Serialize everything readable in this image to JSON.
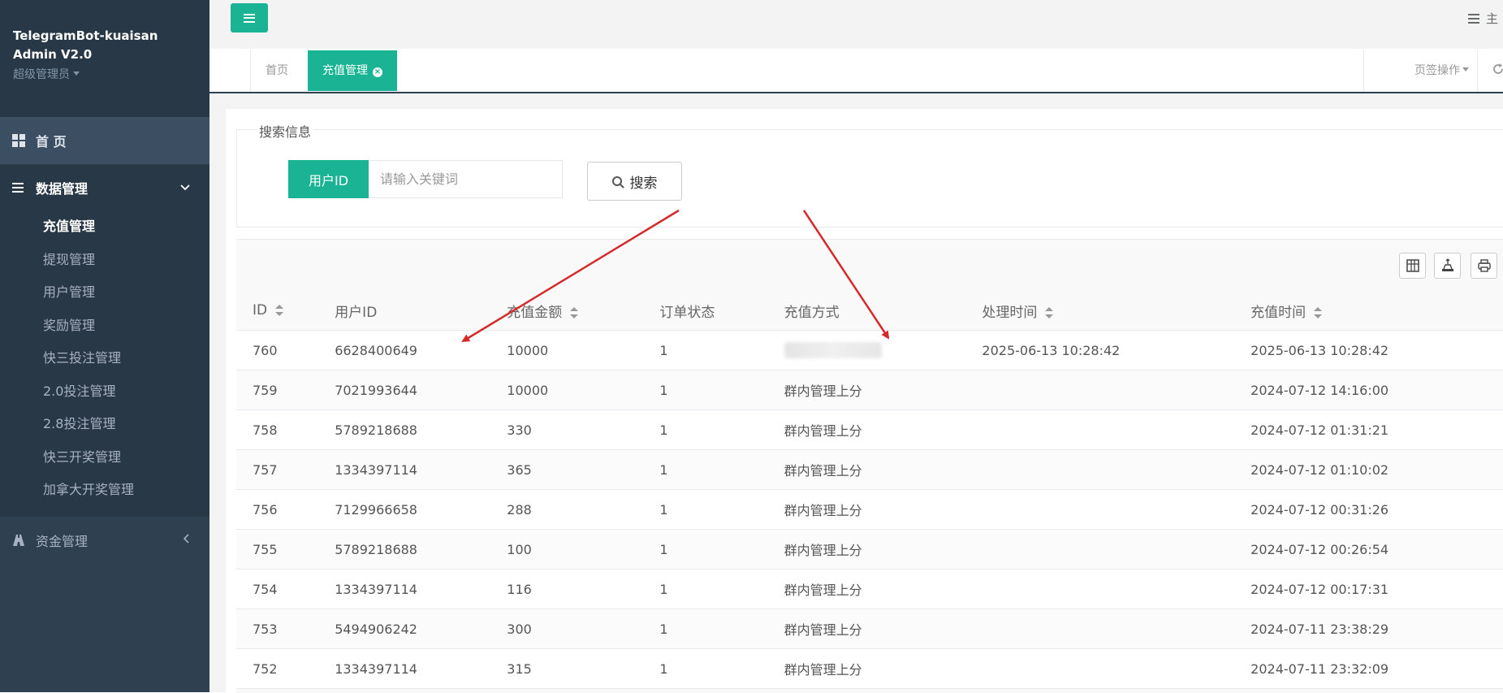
{
  "sidebar": {
    "brand_line1": "TelegramBot-kuaisan",
    "brand_line2": "Admin V2.0",
    "role": "超级管理员",
    "home_label": "首 页",
    "data_mgmt_label": "数据管理",
    "data_mgmt_items": [
      {
        "label": "充值管理",
        "active": true
      },
      {
        "label": "提现管理"
      },
      {
        "label": "用户管理"
      },
      {
        "label": "奖励管理"
      },
      {
        "label": "快三投注管理"
      },
      {
        "label": "2.0投注管理"
      },
      {
        "label": "2.8投注管理"
      },
      {
        "label": "快三开奖管理"
      },
      {
        "label": "加拿大开奖管理"
      }
    ],
    "funds_label": "资金管理"
  },
  "topbar": {
    "right_text": "主"
  },
  "tabs": {
    "items": [
      {
        "label": "首页"
      },
      {
        "label": "充值管理",
        "active": true
      }
    ],
    "ops_label": "页签操作"
  },
  "search": {
    "legend": "搜索信息",
    "field_label": "用户ID",
    "placeholder": "请输入关键词",
    "value": "",
    "button_label": "搜索"
  },
  "table": {
    "columns": [
      "ID",
      "用户ID",
      "充值金额",
      "订单状态",
      "充值方式",
      "处理时间",
      "充值时间"
    ],
    "sortable": [
      true,
      false,
      true,
      false,
      false,
      true,
      true
    ],
    "rows": [
      {
        "id": "760",
        "user_id": "6628400649",
        "amount": "10000",
        "status": "1",
        "method": "",
        "processed": "2025-06-13 10:28:42",
        "recharge_time": "2025-06-13 10:28:42"
      },
      {
        "id": "759",
        "user_id": "7021993644",
        "amount": "10000",
        "status": "1",
        "method": "群内管理上分",
        "processed": "",
        "recharge_time": "2024-07-12 14:16:00"
      },
      {
        "id": "758",
        "user_id": "5789218688",
        "amount": "330",
        "status": "1",
        "method": "群内管理上分",
        "processed": "",
        "recharge_time": "2024-07-12 01:31:21"
      },
      {
        "id": "757",
        "user_id": "1334397114",
        "amount": "365",
        "status": "1",
        "method": "群内管理上分",
        "processed": "",
        "recharge_time": "2024-07-12 01:10:02"
      },
      {
        "id": "756",
        "user_id": "7129966658",
        "amount": "288",
        "status": "1",
        "method": "群内管理上分",
        "processed": "",
        "recharge_time": "2024-07-12 00:31:26"
      },
      {
        "id": "755",
        "user_id": "5789218688",
        "amount": "100",
        "status": "1",
        "method": "群内管理上分",
        "processed": "",
        "recharge_time": "2024-07-12 00:26:54"
      },
      {
        "id": "754",
        "user_id": "1334397114",
        "amount": "116",
        "status": "1",
        "method": "群内管理上分",
        "processed": "",
        "recharge_time": "2024-07-12 00:17:31"
      },
      {
        "id": "753",
        "user_id": "5494906242",
        "amount": "300",
        "status": "1",
        "method": "群内管理上分",
        "processed": "",
        "recharge_time": "2024-07-11 23:38:29"
      },
      {
        "id": "752",
        "user_id": "1334397114",
        "amount": "315",
        "status": "1",
        "method": "群内管理上分",
        "processed": "",
        "recharge_time": "2024-07-11 23:32:09"
      }
    ]
  },
  "colors": {
    "accent": "#1ab394",
    "sidebar_bg": "#2f4050",
    "sidebar_dark": "#293846",
    "annotation_arrow": "#d42a2a"
  },
  "icons": {
    "home": "grid-icon",
    "data_mgmt": "bars-icon",
    "funds": "road-icon",
    "menu_toggle": "hamburger-icon",
    "search": "magnifier-icon",
    "toolbar": [
      "columns-icon",
      "export-icon",
      "print-icon"
    ]
  }
}
